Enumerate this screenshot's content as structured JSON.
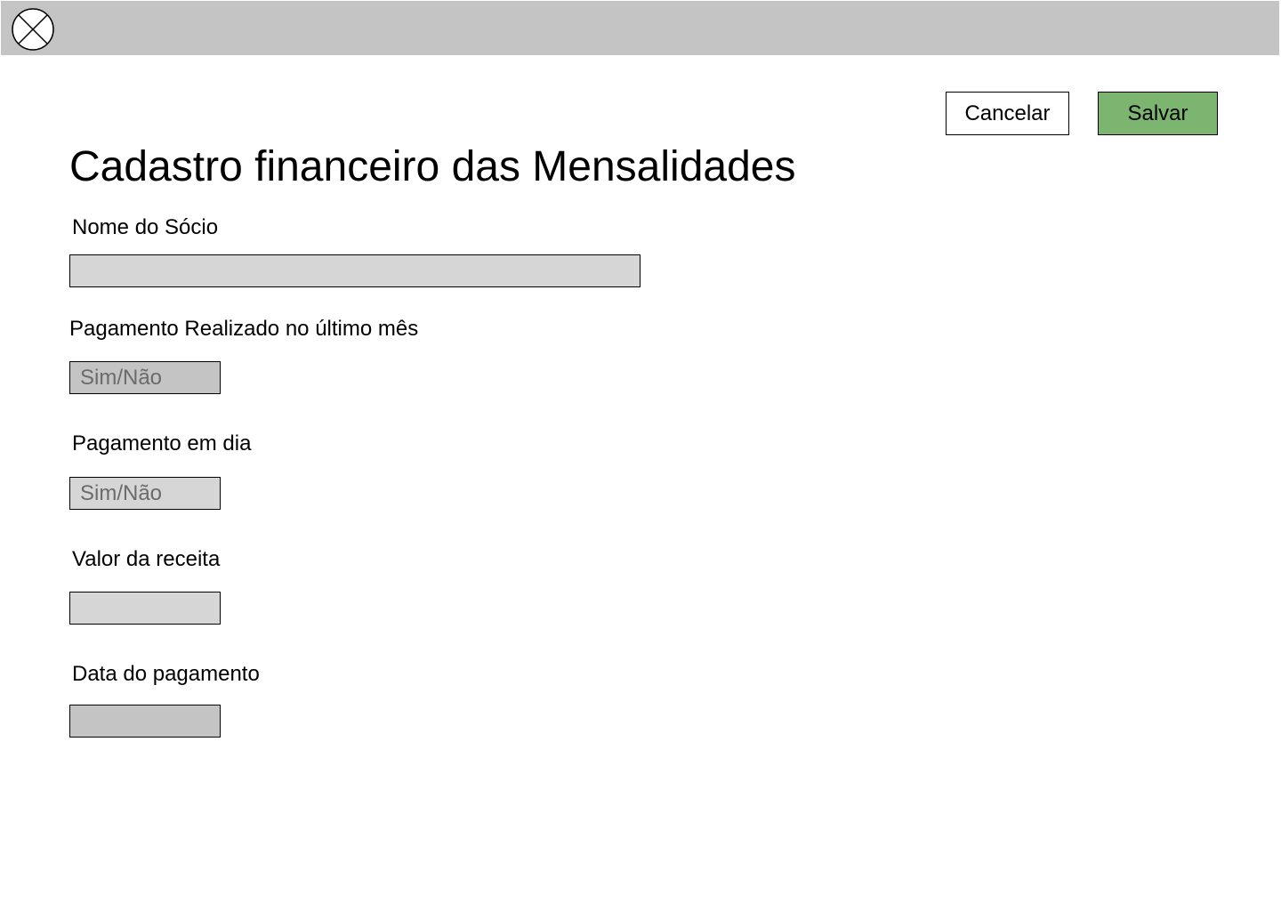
{
  "header": {
    "close_icon": "close-icon"
  },
  "actions": {
    "cancel_label": "Cancelar",
    "save_label": "Salvar",
    "save_color": "#7cb56f"
  },
  "form": {
    "title": "Cadastro financeiro das Mensalidades",
    "fields": [
      {
        "label": "Nome do Sócio",
        "value": "",
        "placeholder": ""
      },
      {
        "label": "Pagamento Realizado no último mês",
        "value": "",
        "placeholder": "Sim/Não"
      },
      {
        "label": "Pagamento em dia",
        "value": "",
        "placeholder": "Sim/Não"
      },
      {
        "label": "Valor da receita",
        "value": "",
        "placeholder": ""
      },
      {
        "label": "Data do pagamento",
        "value": "",
        "placeholder": ""
      }
    ]
  }
}
